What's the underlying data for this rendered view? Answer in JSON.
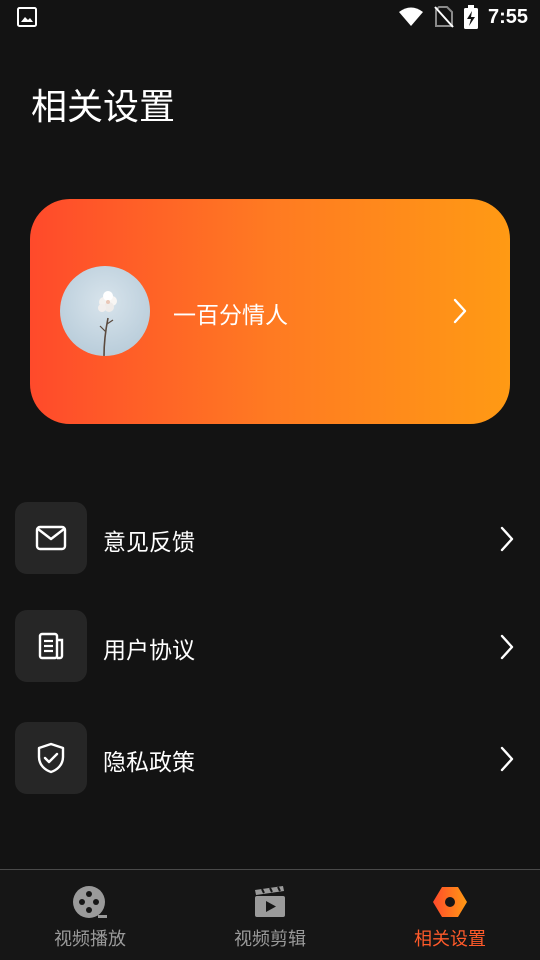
{
  "status_bar": {
    "time": "7:55",
    "icons": [
      "image-icon",
      "wifi-icon",
      "no-sim-icon",
      "battery-charging-icon"
    ]
  },
  "page": {
    "title": "相关设置"
  },
  "profile": {
    "name": "一百分情人",
    "gradient_start": "#ff4a2b",
    "gradient_end": "#ff9a14"
  },
  "menu": {
    "items": [
      {
        "label": "意见反馈",
        "icon": "mail-icon"
      },
      {
        "label": "用户协议",
        "icon": "document-icon"
      },
      {
        "label": "隐私政策",
        "icon": "shield-check-icon"
      }
    ]
  },
  "bottom_nav": {
    "items": [
      {
        "label": "视频播放",
        "icon": "film-reel-icon",
        "active": false
      },
      {
        "label": "视频剪辑",
        "icon": "clapperboard-icon",
        "active": false
      },
      {
        "label": "相关设置",
        "icon": "settings-hexagon-icon",
        "active": true
      }
    ],
    "active_color": "#ff5a2a",
    "inactive_color": "#9a9a9a"
  }
}
